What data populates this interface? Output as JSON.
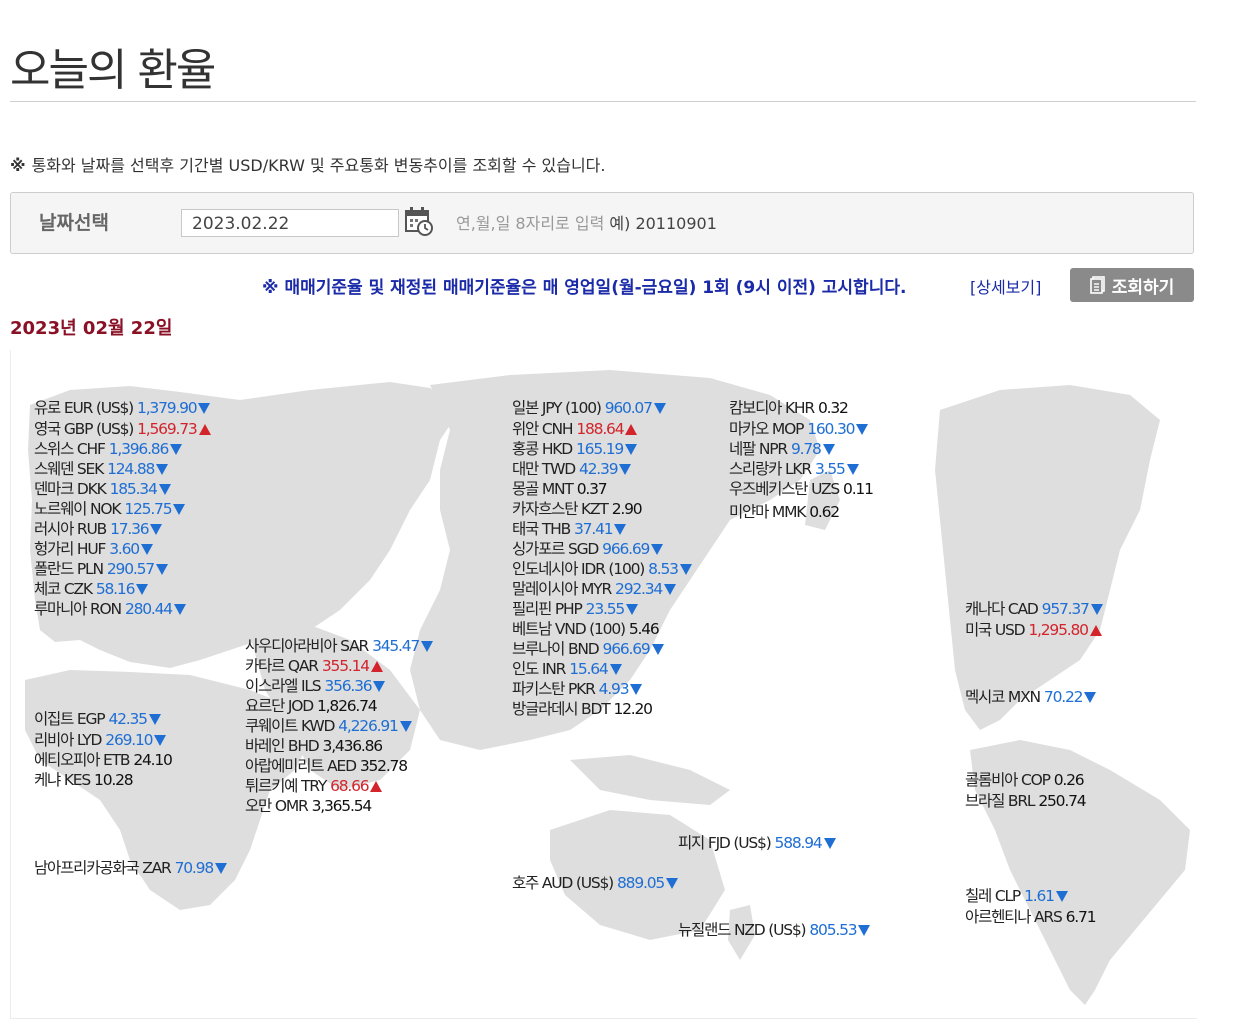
{
  "page": {
    "title": "오늘의 환율",
    "notice_mark": "※",
    "notice": "통화와 날짜를 선택후 기간별 USD/KRW 및 주요통화 변동추이를 조회할 수 있습니다.",
    "date_label": "날짜선택",
    "date_value": "2023.02.22",
    "date_hint": "연,월,일 8자리로 입력",
    "date_hint_example": "예) 20110901",
    "publish_notice": "※ 매매기준율 및 재정된 매매기준율은 매 영업일(월-금요일) 1회 (9시 이전) 고시합니다.",
    "detail_link": "[상세보기]",
    "query_button": "조회하기",
    "date_heading": "2023년 02월 22일"
  },
  "colors": {
    "down": "#1f6ed4",
    "up": "#d3242c",
    "heading": "#8a1026",
    "publish": "#1a2aa8"
  },
  "rates": [
    {
      "label": "유로 EUR (US$)",
      "value": "1,379.90",
      "dir": "down"
    },
    {
      "label": "영국 GBP (US$)",
      "value": "1,569.73",
      "dir": "up"
    },
    {
      "label": "스위스 CHF",
      "value": "1,396.86",
      "dir": "down"
    },
    {
      "label": "스웨덴 SEK",
      "value": "124.88",
      "dir": "down"
    },
    {
      "label": "덴마크 DKK",
      "value": "185.34",
      "dir": "down"
    },
    {
      "label": "노르웨이 NOK",
      "value": "125.75",
      "dir": "down"
    },
    {
      "label": "러시아 RUB",
      "value": "17.36",
      "dir": "down"
    },
    {
      "label": "헝가리 HUF",
      "value": "3.60",
      "dir": "down"
    },
    {
      "label": "폴란드 PLN",
      "value": "290.57",
      "dir": "down"
    },
    {
      "label": "체코 CZK",
      "value": "58.16",
      "dir": "down"
    },
    {
      "label": "루마니아 RON",
      "value": "280.44",
      "dir": "down"
    },
    {
      "label": "이집트 EGP",
      "value": "42.35",
      "dir": "down"
    },
    {
      "label": "리비아 LYD",
      "value": "269.10",
      "dir": "down"
    },
    {
      "label": "에티오피아 ETB",
      "value": "24.10",
      "dir": "flat"
    },
    {
      "label": "케냐 KES",
      "value": "10.28",
      "dir": "flat"
    },
    {
      "label": "남아프리카공화국 ZAR",
      "value": "70.98",
      "dir": "down"
    },
    {
      "label": "사우디아라비아 SAR",
      "value": "345.47",
      "dir": "down"
    },
    {
      "label": "카타르 QAR",
      "value": "355.14",
      "dir": "up"
    },
    {
      "label": "이스라엘 ILS",
      "value": "356.36",
      "dir": "down"
    },
    {
      "label": "요르단 JOD",
      "value": "1,826.74",
      "dir": "flat"
    },
    {
      "label": "쿠웨이트 KWD",
      "value": "4,226.91",
      "dir": "down"
    },
    {
      "label": "바레인 BHD",
      "value": "3,436.86",
      "dir": "flat"
    },
    {
      "label": "아랍에미리트 AED",
      "value": "352.78",
      "dir": "flat"
    },
    {
      "label": "튀르키예 TRY",
      "value": "68.66",
      "dir": "up"
    },
    {
      "label": "오만 OMR",
      "value": "3,365.54",
      "dir": "flat"
    },
    {
      "label": "일본 JPY (100)",
      "value": "960.07",
      "dir": "down"
    },
    {
      "label": "위안 CNH",
      "value": "188.64",
      "dir": "up"
    },
    {
      "label": "홍콩 HKD",
      "value": "165.19",
      "dir": "down"
    },
    {
      "label": "대만 TWD",
      "value": "42.39",
      "dir": "down"
    },
    {
      "label": "몽골 MNT",
      "value": "0.37",
      "dir": "flat"
    },
    {
      "label": "카자흐스탄 KZT",
      "value": "2.90",
      "dir": "flat"
    },
    {
      "label": "태국 THB",
      "value": "37.41",
      "dir": "down"
    },
    {
      "label": "싱가포르 SGD",
      "value": "966.69",
      "dir": "down"
    },
    {
      "label": "인도네시아 IDR (100)",
      "value": "8.53",
      "dir": "down"
    },
    {
      "label": "말레이시아 MYR",
      "value": "292.34",
      "dir": "down"
    },
    {
      "label": "필리핀 PHP",
      "value": "23.55",
      "dir": "down"
    },
    {
      "label": "베트남 VND (100)",
      "value": "5.46",
      "dir": "flat"
    },
    {
      "label": "브루나이 BND",
      "value": "966.69",
      "dir": "down"
    },
    {
      "label": "인도 INR",
      "value": "15.64",
      "dir": "down"
    },
    {
      "label": "파키스탄 PKR",
      "value": "4.93",
      "dir": "down"
    },
    {
      "label": "방글라데시 BDT",
      "value": "12.20",
      "dir": "flat"
    },
    {
      "label": "캄보디아 KHR",
      "value": "0.32",
      "dir": "flat"
    },
    {
      "label": "마카오 MOP",
      "value": "160.30",
      "dir": "down"
    },
    {
      "label": "네팔 NPR",
      "value": "9.78",
      "dir": "down"
    },
    {
      "label": "스리랑카 LKR",
      "value": "3.55",
      "dir": "down"
    },
    {
      "label": "우즈베키스탄 UZS",
      "value": "0.11",
      "dir": "flat"
    },
    {
      "label": "미얀마 MMK",
      "value": "0.62",
      "dir": "flat"
    },
    {
      "label": "피지 FJD (US$)",
      "value": "588.94",
      "dir": "down"
    },
    {
      "label": "호주 AUD (US$)",
      "value": "889.05",
      "dir": "down"
    },
    {
      "label": "뉴질랜드 NZD (US$)",
      "value": "805.53",
      "dir": "down"
    },
    {
      "label": "캐나다 CAD",
      "value": "957.37",
      "dir": "down"
    },
    {
      "label": "미국 USD",
      "value": "1,295.80",
      "dir": "up"
    },
    {
      "label": "멕시코 MXN",
      "value": "70.22",
      "dir": "down"
    },
    {
      "label": "콜롬비아 COP",
      "value": "0.26",
      "dir": "flat"
    },
    {
      "label": "브라질 BRL",
      "value": "250.74",
      "dir": "flat"
    },
    {
      "label": "칠레 CLP",
      "value": "1.61",
      "dir": "down"
    },
    {
      "label": "아르헨티나 ARS",
      "value": "6.71",
      "dir": "flat"
    }
  ]
}
